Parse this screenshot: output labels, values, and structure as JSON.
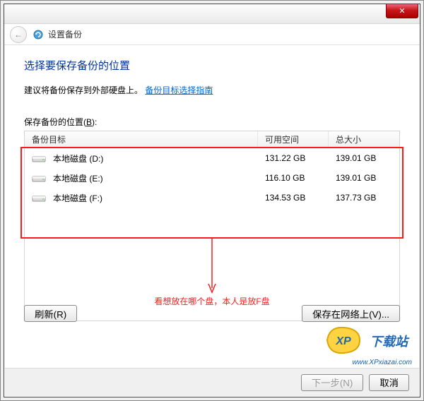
{
  "window": {
    "title": "设置备份",
    "close_glyph": "✕"
  },
  "page": {
    "heading": "选择要保存备份的位置",
    "suggestion_text": "建议将备份保存到外部硬盘上。",
    "suggestion_link": "备份目标选择指南",
    "location_label": "保存备份的位置(",
    "location_accel": "B",
    "location_suffix": "):"
  },
  "table": {
    "columns": {
      "target": "备份目标",
      "free": "可用空间",
      "total": "总大小"
    },
    "rows": [
      {
        "name": "本地磁盘 (D:)",
        "free": "131.22 GB",
        "total": "139.01 GB"
      },
      {
        "name": "本地磁盘 (E:)",
        "free": "116.10 GB",
        "total": "139.01 GB"
      },
      {
        "name": "本地磁盘 (F:)",
        "free": "134.53 GB",
        "total": "137.73 GB"
      }
    ]
  },
  "annotation": {
    "note": "看想放在哪个盘，本人是放F盘"
  },
  "buttons": {
    "refresh": "刷新(R)",
    "save_network": "保存在网络上(V)...",
    "next": "下一步(N)",
    "cancel": "取消"
  },
  "watermark": {
    "brand1": "XP",
    "brand2": "下载站",
    "url": "www.XPxiazai.com"
  }
}
